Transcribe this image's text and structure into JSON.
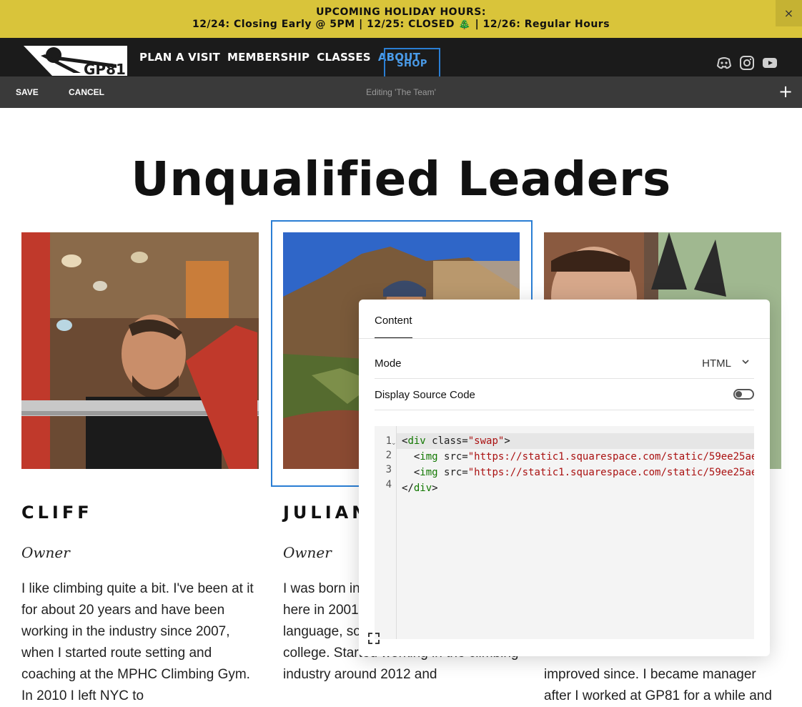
{
  "announcement": {
    "line1": "UPCOMING HOLIDAY HOURS:",
    "line2": "12/24: Closing Early @ 5PM | 12/25: CLOSED 🎄 | 12/26: Regular Hours",
    "close": "×"
  },
  "header": {
    "logo_text": "GP81",
    "nav": [
      "PLAN A VISIT",
      "MEMBERSHIP",
      "CLASSES",
      "ABOUT"
    ],
    "active_nav": "ABOUT",
    "shop": "SHOP",
    "social": [
      "discord-icon",
      "instagram-icon",
      "youtube-icon"
    ],
    "accent": "#4a9be8"
  },
  "editbar": {
    "save": "SAVE",
    "cancel": "CANCEL",
    "status": "Editing 'The Team'",
    "add": "+"
  },
  "page": {
    "title": "Unqualified Leaders"
  },
  "team": [
    {
      "name": "CLIFF",
      "role": "Owner",
      "bio": "I like climbing quite a bit. I've been at it for about 20 years and have been working in the industry since 2007, when I started route setting and coaching at the MPHC Climbing Gym. In 2010 I left NYC to"
    },
    {
      "name": "JULIAN",
      "role": "Owner",
      "bio": "I was born in Colombia and moved here in 2001 not knowing the language, somehow made it through college. Started working in the climbing industry around 2012 and"
    },
    {
      "name": "",
      "role": "",
      "bio": "improved since. I became manager after I worked at GP81 for a while and"
    }
  ],
  "panel": {
    "tab": "Content",
    "mode_label": "Mode",
    "mode_value": "HTML",
    "source_label": "Display Source Code",
    "source_on": false,
    "line_numbers": [
      "1",
      "2",
      "3",
      "4"
    ],
    "code": [
      {
        "open": "<",
        "tag": "div",
        "attr": " class=",
        "str": "\"swap\"",
        "close": ">"
      },
      {
        "indent": "  ",
        "open": "<",
        "tag": "img",
        "attr": " src=",
        "str": "\"https://static1.squarespace.com/static/59ee25ae",
        "close": ""
      },
      {
        "indent": "  ",
        "open": "<",
        "tag": "img",
        "attr": " src=",
        "str": "\"https://static1.squarespace.com/static/59ee25ae",
        "close": ""
      },
      {
        "open": "</",
        "tag": "div",
        "attr": "",
        "str": "",
        "close": ">"
      }
    ]
  }
}
